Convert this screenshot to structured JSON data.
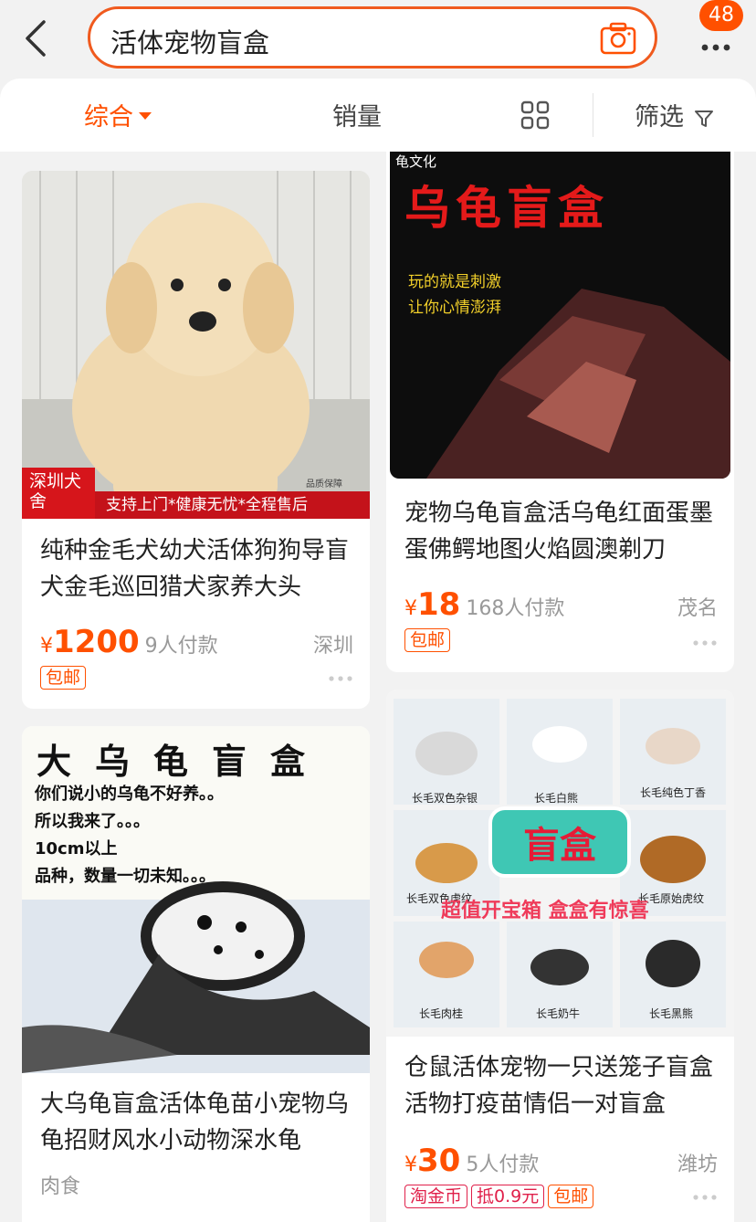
{
  "search": {
    "query": "活体宠物盲盒",
    "badge_count": "48"
  },
  "sort": {
    "comprehensive": "综合",
    "sales": "销量",
    "filter": "筛选"
  },
  "products": [
    {
      "title": "纯种金毛犬幼犬活体狗狗导盲犬金毛巡回猎犬家养大头",
      "price": "1200",
      "currency": "¥",
      "paid": "9人付款",
      "location": "深圳",
      "tags": [
        "包邮"
      ],
      "image": {
        "ribbon_left": "深圳犬舍",
        "ribbon_text": "支持上门*健康无忧*全程售后",
        "small_text": "品质保障"
      }
    },
    {
      "title": "宠物乌龟盲盒活乌龟红面蛋墨蛋佛鳄地图火焰圆澳剃刀",
      "price": "18",
      "currency": "¥",
      "paid": "168人付款",
      "location": "茂名",
      "tags": [
        "包邮"
      ],
      "image": {
        "logo": "龟文化",
        "headline": "乌龟盲盒",
        "line1": "玩的就是刺激",
        "line2": "让你心情澎湃"
      }
    },
    {
      "title": "大乌龟盲盒活体龟苗小宠物乌龟招财风水小动物深水龟",
      "subtext": "肉食",
      "image": {
        "headline": "大乌龟盲盒",
        "lines": [
          "你们说小的乌龟不好养。。",
          "所以我来了。。。",
          "10cm以上",
          "品种，数量一切未知。。。"
        ]
      }
    },
    {
      "title": "仓鼠活体宠物一只送笼子盲盒活物打疫苗情侣一对盲盒",
      "price": "30",
      "currency": "¥",
      "paid": "5人付款",
      "location": "潍坊",
      "tags": [
        "淘金币",
        "抵0.9元",
        "包邮"
      ],
      "image": {
        "center": "盲盒",
        "sub": "超值开宝箱 盒盒有惊喜",
        "captions": [
          "长毛双色杂银",
          "长毛白熊",
          "长毛纯色丁香",
          "长毛双色虎纹",
          "长毛原始虎纹",
          "长毛肉桂",
          "长毛奶牛",
          "长毛黑熊"
        ]
      }
    }
  ]
}
